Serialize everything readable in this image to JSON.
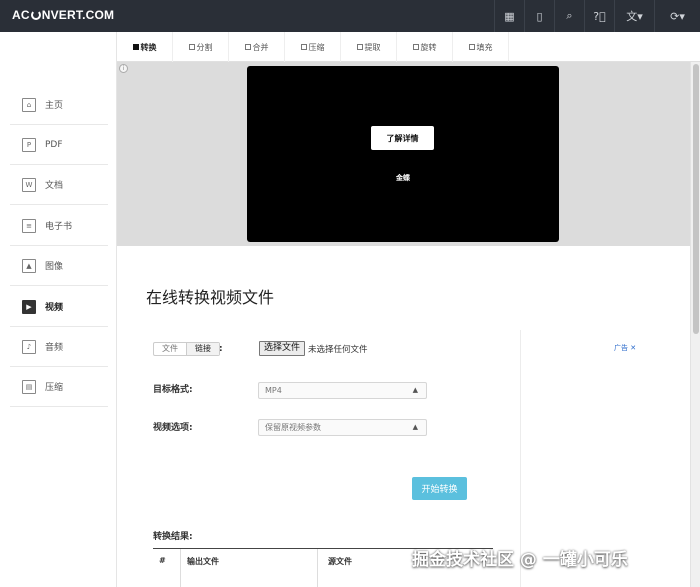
{
  "header": {
    "logo_left": "AC",
    "logo_right": "NVERT.COM",
    "icons": [
      "grid-icon",
      "tablet-icon",
      "search-icon",
      "help-icon",
      "language-icon",
      "refresh-icon"
    ]
  },
  "sidebar": {
    "items": [
      {
        "label": "主页",
        "icon": "home-icon"
      },
      {
        "label": "PDF",
        "icon": "pdf-icon"
      },
      {
        "label": "文档",
        "icon": "document-icon"
      },
      {
        "label": "电子书",
        "icon": "ebook-icon"
      },
      {
        "label": "图像",
        "icon": "image-icon"
      },
      {
        "label": "视频",
        "icon": "video-icon",
        "active": true
      },
      {
        "label": "音频",
        "icon": "audio-icon"
      },
      {
        "label": "压缩",
        "icon": "archive-icon"
      }
    ]
  },
  "tabs": [
    {
      "label": "转换",
      "active": true
    },
    {
      "label": "分割"
    },
    {
      "label": "合并"
    },
    {
      "label": "压缩"
    },
    {
      "label": "提取"
    },
    {
      "label": "旋转"
    },
    {
      "label": "填充"
    }
  ],
  "ad": {
    "button_label": "了解详情",
    "text": "金蝶"
  },
  "main": {
    "title": "在线转换视频文件",
    "source_tabs": [
      "文件",
      "链接"
    ],
    "colon": ":",
    "file_button": "选择文件",
    "file_status": "未选择任何文件",
    "target_format_label": "目标格式:",
    "target_format_value": "MP4",
    "video_options_label": "视频选项:",
    "video_options_value": "保留原视频参数",
    "start_button": "开始转换",
    "results_label": "转换结果:",
    "results_columns": [
      "#",
      "输出文件",
      "源文件"
    ]
  },
  "side_ad_label": "广告 ✕",
  "watermark": "掘金技术社区 @ 一罐小可乐"
}
